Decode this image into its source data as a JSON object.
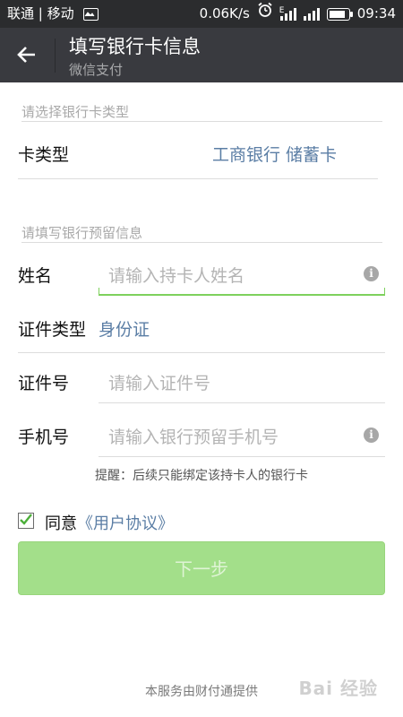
{
  "status_bar": {
    "carrier": "联通 | 移动",
    "speed": "0.06K/s",
    "network": "E",
    "time": "09:34",
    "battery_level": 0.9
  },
  "app_bar": {
    "title": "填写银行卡信息",
    "subtitle": "微信支付",
    "back_icon": "arrow-left-icon"
  },
  "card_section": {
    "header": "请选择银行卡类型",
    "card_type_label": "卡类型",
    "card_type_value": "工商银行 储蓄卡"
  },
  "info_section": {
    "header": "请填写银行预留信息",
    "name_label": "姓名",
    "name_placeholder": "请输入持卡人姓名",
    "id_type_label": "证件类型",
    "id_type_value": "身份证",
    "id_number_label": "证件号",
    "id_number_placeholder": "请输入证件号",
    "phone_label": "手机号",
    "phone_placeholder": "请输入银行预留手机号"
  },
  "reminder": "提醒：后续只能绑定该持卡人的银行卡",
  "agreement": {
    "checked": true,
    "prefix": "同意",
    "link": "《用户协议》"
  },
  "next_button": "下一步",
  "footer": "本服务由财付通提供",
  "colors": {
    "accent_green": "#a3df8a",
    "link_blue": "#5b7ea5",
    "app_bar": "#393a3f",
    "status_bar": "#2b2c2e"
  }
}
